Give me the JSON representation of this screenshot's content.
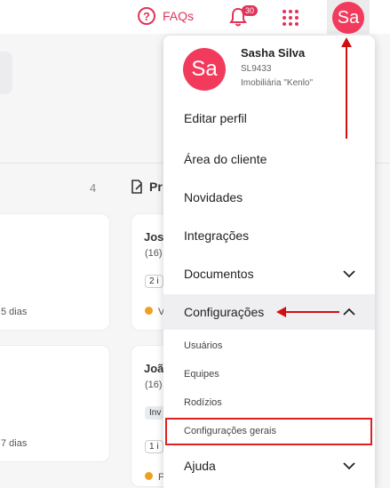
{
  "topbar": {
    "faqs_label": "FAQs",
    "notifications_count": "30",
    "avatar_initials": "Sa",
    "accent_color": "#e0345a"
  },
  "background": {
    "column_count": "4",
    "column2_title_partial": "Pr",
    "cards": [
      {
        "text": "5 dias"
      },
      {
        "text": "7 dias"
      },
      {
        "name": "Jos",
        "sub": "(16)",
        "chip": "2 i",
        "extra": "V"
      },
      {
        "name": "Joã",
        "sub": "(16)",
        "chip_filled": "Inv",
        "chip": "1 i",
        "extra": "F"
      }
    ]
  },
  "menu": {
    "avatar_initials": "Sa",
    "user_name": "Sasha Silva",
    "user_code": "SL9433",
    "company": "Imobiliária \"Kenlo\"",
    "items": [
      {
        "label": "Editar perfil"
      },
      {
        "label": "Área do cliente"
      },
      {
        "label": "Novidades"
      },
      {
        "label": "Integrações"
      },
      {
        "label": "Documentos"
      },
      {
        "label": "Configurações"
      }
    ],
    "subitems": [
      {
        "label": "Usuários"
      },
      {
        "label": "Equipes"
      },
      {
        "label": "Rodízios"
      },
      {
        "label": "Configurações gerais"
      }
    ],
    "help_label": "Ajuda"
  }
}
